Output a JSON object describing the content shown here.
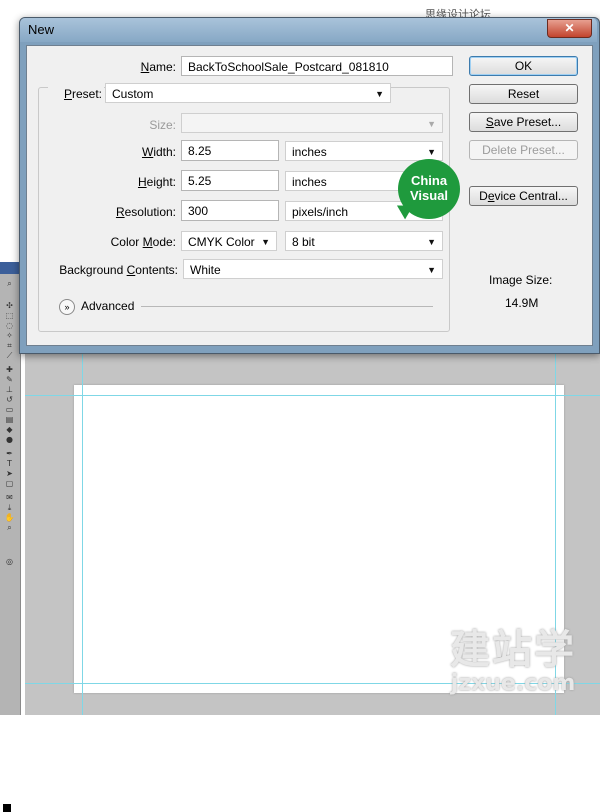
{
  "dialog": {
    "title": "New",
    "close_glyph": "✕",
    "name_label": "Name:",
    "name_value": "BackToSchoolSale_Postcard_081810",
    "preset_label": "Preset:",
    "preset_value": "Custom",
    "size_label": "Size:",
    "size_value": "",
    "width_label": "Width:",
    "width_value": "8.25",
    "width_unit": "inches",
    "height_label": "Height:",
    "height_value": "5.25",
    "height_unit": "inches",
    "resolution_label": "Resolution:",
    "resolution_value": "300",
    "resolution_unit": "pixels/inch",
    "color_mode_label": "Color Mode:",
    "color_mode_value": "CMYK Color",
    "bit_depth_value": "8 bit",
    "background_label": "Background Contents:",
    "background_value": "White",
    "advanced_label": "Advanced",
    "image_size_label": "Image Size:",
    "image_size_value": "14.9M"
  },
  "buttons": {
    "ok": "OK",
    "reset": "Reset",
    "save_preset": "Save Preset...",
    "delete_preset": "Delete Preset...",
    "device_central": "Device Central..."
  },
  "badge": {
    "line1": "China",
    "line2": "Visual"
  },
  "watermarks": {
    "top": "思缘设计论坛  www.missyuan.com",
    "bottom_cn": "建站学",
    "bottom_url": "jzxue.com"
  },
  "icons": {
    "close": "close-icon",
    "advanced_toggle": "chevron-double-down-icon",
    "dropdown": "chevron-down-icon"
  },
  "colors": {
    "titlebar": "#8fb0cc",
    "badge": "#1f9a3d",
    "guide": "#7fd7e6",
    "workspace": "#c4c4c4"
  }
}
